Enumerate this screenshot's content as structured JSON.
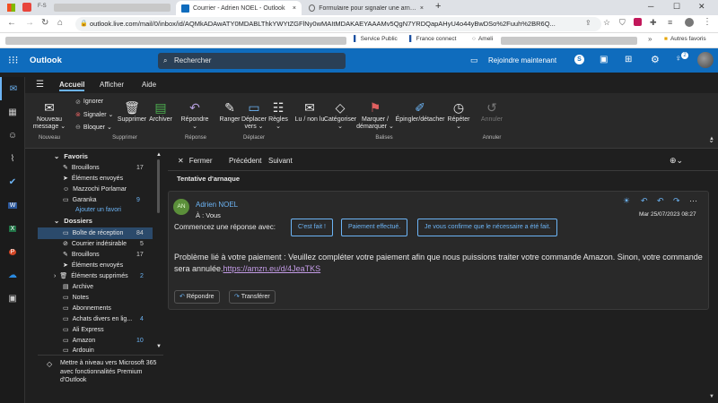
{
  "browser": {
    "tabs": [
      {
        "title": "Courrier - Adrien NOEL - Outlook",
        "close": "×"
      },
      {
        "title": "Formulaire pour signaler une arnaque m",
        "close": "×"
      }
    ],
    "new_tab": "+",
    "url": "outlook.live.com/mail/0/inbox/id/AQMkADAwATY0MDABLThkYWYtZGFlNy0wMAItMDAKAEYAAAMv5QgN7YRDQapAHyU4o44yBwDSo%2Fuuh%2BR6Q...",
    "bookmarks": [
      {
        "label": "Service Public"
      },
      {
        "label": "France connect"
      },
      {
        "label": "Ameli"
      },
      {
        "label": "Autres favoris"
      }
    ]
  },
  "outlook": {
    "app_name": "Outlook",
    "search_placeholder": "Rechercher",
    "join_label": "Rejoindre maintenant",
    "badge": "2"
  },
  "ribbon": {
    "tabs": [
      "Accueil",
      "Afficher",
      "Aide"
    ],
    "buttons": {
      "new": "Nouveau message ⌄",
      "ignore": "Ignorer",
      "report": "Signaler ⌄",
      "block": "Bloquer ⌄",
      "delete": "Supprimer",
      "archive": "Archiver",
      "reply": "Répondre ⌄",
      "sweep": "Ranger",
      "move": "Déplacer vers ⌄",
      "rules": "Règles ⌄",
      "read": "Lu / non lu",
      "categorize": "Catégoriser ⌄",
      "flag": "Marquer / démarquer ⌄",
      "pin": "Épingler/détacher",
      "snooze": "Répéter ⌄",
      "undo": "Annuler"
    },
    "groups": [
      "Nouveau",
      "Supprimer",
      "Réponse",
      "Déplacer",
      "Balises",
      "Annuler"
    ]
  },
  "folders": {
    "favorites_label": "Favoris",
    "favorites": [
      {
        "name": "Brouillons",
        "count": "17"
      },
      {
        "name": "Éléments envoyés",
        "count": ""
      },
      {
        "name": "Mazzochi Porlamar",
        "count": ""
      },
      {
        "name": "Garanka",
        "count": "9"
      }
    ],
    "add_favorite": "Ajouter un favori",
    "folders_label": "Dossiers",
    "items": [
      {
        "name": "Boîte de réception",
        "count": "84"
      },
      {
        "name": "Courrier indésirable",
        "count": "5"
      },
      {
        "name": "Brouillons",
        "count": "17"
      },
      {
        "name": "Éléments envoyés",
        "count": ""
      },
      {
        "name": "Éléments supprimés",
        "count": "2"
      },
      {
        "name": "Archive",
        "count": ""
      },
      {
        "name": "Notes",
        "count": ""
      },
      {
        "name": "Abonnements",
        "count": ""
      },
      {
        "name": "Achats divers en lig...",
        "count": "4"
      },
      {
        "name": "Ali Express",
        "count": ""
      },
      {
        "name": "Amazon",
        "count": "10"
      },
      {
        "name": "Ardouin",
        "count": ""
      }
    ],
    "upgrade_text": "Mettre à niveau vers Microsoft 365 avec fonctionnalités Premium d'Outlook"
  },
  "reading": {
    "close": "Fermer",
    "previous": "Précédent",
    "next": "Suivant",
    "subject": "Tentative d'arnaque",
    "sender_initials": "AN",
    "sender": "Adrien NOEL",
    "to": "À : Vous",
    "date": "Mar 25/07/2023 08:27",
    "suggest_label": "Commencez une réponse avec:",
    "suggestions": [
      "C'est fait !",
      "Paiement effectué.",
      "Je vous confirme que le nécessaire a été fait."
    ],
    "body": "Problème lié à votre paiement : Veuillez compléter votre paiement afin que nous puissions traiter votre commande Amazon. Sinon, votre commande sera annulée.",
    "link": "https://amzn.eu/d/4JeaTKS",
    "reply": "Répondre",
    "forward": "Transférer"
  },
  "colors": {
    "accent": "#0f6cbd",
    "link": "#6cb4f5",
    "selected": "#2b4a6b"
  }
}
